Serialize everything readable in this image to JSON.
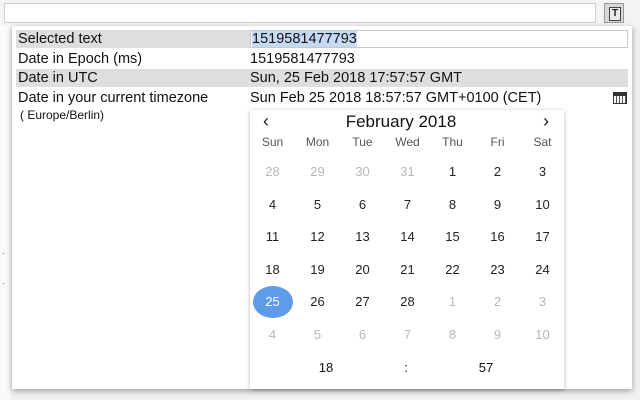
{
  "extension_icon_glyph": "T",
  "rows": [
    {
      "label": "Selected text",
      "value": "1519581477793"
    },
    {
      "label": "Date in Epoch (ms)",
      "value": "1519581477793"
    },
    {
      "label": "Date in UTC",
      "value": "Sun, 25 Feb 2018 17:57:57 GMT"
    },
    {
      "label": "Date in your current timezone",
      "value": "Sun Feb 25 2018 18:57:57 GMT+0100 (CET)"
    }
  ],
  "timezone_name": "( Europe/Berlin)",
  "picker": {
    "prev": "‹",
    "next": "›",
    "title": "February 2018",
    "weekdays": [
      "Sun",
      "Mon",
      "Tue",
      "Wed",
      "Thu",
      "Fri",
      "Sat"
    ],
    "weeks": [
      [
        {
          "d": "28",
          "m": true
        },
        {
          "d": "29",
          "m": true
        },
        {
          "d": "30",
          "m": true
        },
        {
          "d": "31",
          "m": true
        },
        {
          "d": "1"
        },
        {
          "d": "2"
        },
        {
          "d": "3"
        }
      ],
      [
        {
          "d": "4"
        },
        {
          "d": "5"
        },
        {
          "d": "6"
        },
        {
          "d": "7"
        },
        {
          "d": "8"
        },
        {
          "d": "9"
        },
        {
          "d": "10"
        }
      ],
      [
        {
          "d": "11"
        },
        {
          "d": "12"
        },
        {
          "d": "13"
        },
        {
          "d": "14"
        },
        {
          "d": "15"
        },
        {
          "d": "16"
        },
        {
          "d": "17"
        }
      ],
      [
        {
          "d": "18"
        },
        {
          "d": "19"
        },
        {
          "d": "20"
        },
        {
          "d": "21"
        },
        {
          "d": "22"
        },
        {
          "d": "23"
        },
        {
          "d": "24"
        }
      ],
      [
        {
          "d": "25",
          "sel": true
        },
        {
          "d": "26"
        },
        {
          "d": "27"
        },
        {
          "d": "28"
        },
        {
          "d": "1",
          "m": true
        },
        {
          "d": "2",
          "m": true
        },
        {
          "d": "3",
          "m": true
        }
      ],
      [
        {
          "d": "4",
          "m": true
        },
        {
          "d": "5",
          "m": true
        },
        {
          "d": "6",
          "m": true
        },
        {
          "d": "7",
          "m": true
        },
        {
          "d": "8",
          "m": true
        },
        {
          "d": "9",
          "m": true
        },
        {
          "d": "10",
          "m": true
        }
      ]
    ],
    "time": {
      "hour": "18",
      "sep": ":",
      "minute": "57"
    }
  },
  "colors": {
    "selected_day": "#5e9be8",
    "row_shade": "#dedede",
    "text_highlight": "#c5daf6"
  }
}
